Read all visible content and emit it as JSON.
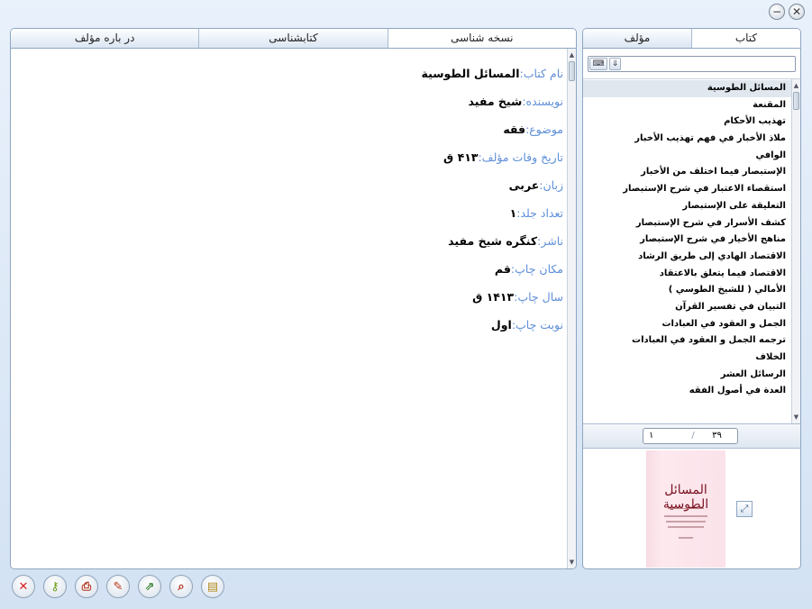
{
  "window": {
    "minimize_glyph": "−",
    "close_glyph": "✕"
  },
  "left_panel": {
    "tabs": [
      {
        "label": "در باره مؤلف",
        "active": false
      },
      {
        "label": "کتابشناسی",
        "active": false
      },
      {
        "label": "نسخه شناسی",
        "active": true
      }
    ],
    "details": [
      {
        "label": "نام کتاب:",
        "value": "المسائل الطوسية"
      },
      {
        "label": "نويسنده:",
        "value": "شيخ مفيد"
      },
      {
        "label": "موضوع:",
        "value": "فقه"
      },
      {
        "label": "تاريخ وفات مؤلف:",
        "value": "۴۱۳ ق"
      },
      {
        "label": "زبان:",
        "value": "عربى"
      },
      {
        "label": "تعداد جلد:",
        "value": "۱"
      },
      {
        "label": "ناشر:",
        "value": "كنگره شيخ مفيد"
      },
      {
        "label": "مكان چاپ:",
        "value": "قم"
      },
      {
        "label": "سال چاپ:",
        "value": "۱۴۱۳ ق"
      },
      {
        "label": "نوبت چاپ:",
        "value": "اول"
      }
    ]
  },
  "right_panel": {
    "tabs": [
      {
        "label": "مؤلف",
        "active": false
      },
      {
        "label": "کتاب",
        "active": true
      }
    ],
    "search": {
      "value": "",
      "keyboard_icon": "keyboard-icon",
      "down_icon": "arrow-down-icon"
    },
    "books": [
      "المسائل الطوسية",
      "المقنعة",
      "تهذيب الأحكام",
      "ملاذ الأخبار في فهم تهذيب الأخبار",
      "الوافي",
      "الإستبصار فيما اختلف من الأخبار",
      "استقصاء الاعتبار في شرح الإستبصار",
      "التعليقة على الإستبصار",
      "كشف الأسرار في شرح الإستبصار",
      "مناهج الأخيار في شرح الإستبصار",
      "الاقتصاد الهادي إلى طريق الرشاد",
      "الاقتصاد فيما يتعلق بالاعتقاد",
      "الأمالي ( للشيخ الطوسي )",
      "التبيان في تفسير القرآن",
      "الجمل و العقود في العبادات",
      "ترجمه الجمل و العقود في العبادات",
      "الخلاف",
      "الرسائل العشر",
      "العدة في أصول الفقه"
    ],
    "selected_index": 0,
    "pager": {
      "current": "۱",
      "total": "۳۹"
    },
    "cover_title": "المسائل الطوسية"
  },
  "toolbar": [
    {
      "name": "close-button",
      "icon": "close-icon",
      "glyph": "✕",
      "color": "#d42020"
    },
    {
      "name": "key-button",
      "icon": "key-icon",
      "glyph": "⚷",
      "color": "#6a9a10"
    },
    {
      "name": "print-button",
      "icon": "printer-icon",
      "glyph": "⎙",
      "color": "#b0301a"
    },
    {
      "name": "edit-button",
      "icon": "edit-icon",
      "glyph": "✎",
      "color": "#b0301a"
    },
    {
      "name": "export-button",
      "icon": "export-icon",
      "glyph": "⇗",
      "color": "#2a7a2a"
    },
    {
      "name": "search-button",
      "icon": "magnifier-icon",
      "glyph": "⌕",
      "color": "#b0301a"
    },
    {
      "name": "notes-button",
      "icon": "notes-icon",
      "glyph": "▤",
      "color": "#b08a20"
    }
  ]
}
